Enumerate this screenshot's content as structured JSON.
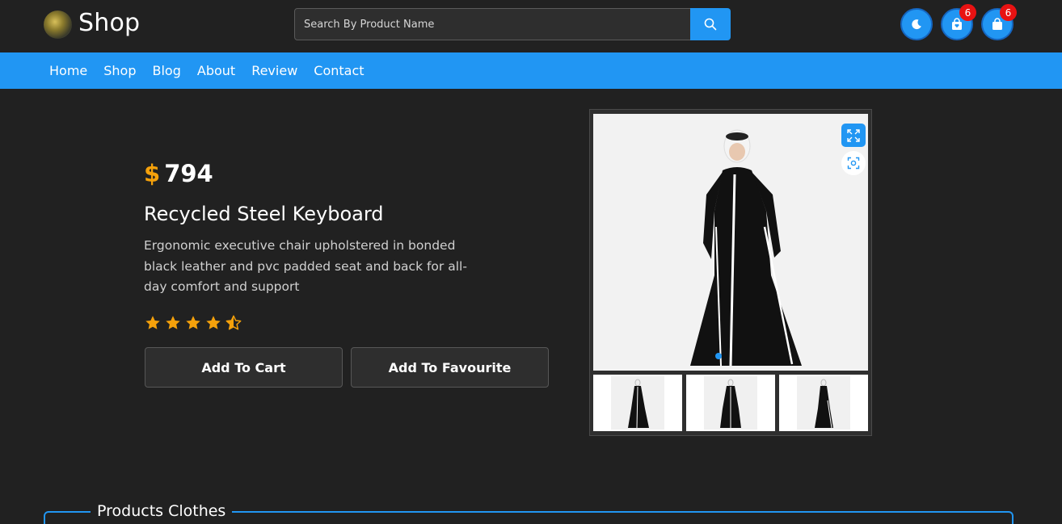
{
  "header": {
    "brand": "Shop",
    "search_placeholder": "Search By Product Name",
    "wishlist_count": "6",
    "cart_count": "6"
  },
  "nav": {
    "items": [
      "Home",
      "Shop",
      "Blog",
      "About",
      "Review",
      "Contact"
    ]
  },
  "product": {
    "currency": "$",
    "price": "794",
    "title": "Recycled Steel Keyboard",
    "description": "Ergonomic executive chair upholstered in bonded black leather and pvc padded seat and back for all-day comfort and support",
    "rating": 4.5,
    "rating_max": 5,
    "add_to_cart_label": "Add To Cart",
    "add_to_favourite_label": "Add To Favourite"
  },
  "section": {
    "title": "Products Clothes"
  },
  "colors": {
    "accent": "#2196f3",
    "price": "#f5a10b",
    "star": "#f5a10b",
    "badge": "#e81212",
    "background": "#212121"
  }
}
